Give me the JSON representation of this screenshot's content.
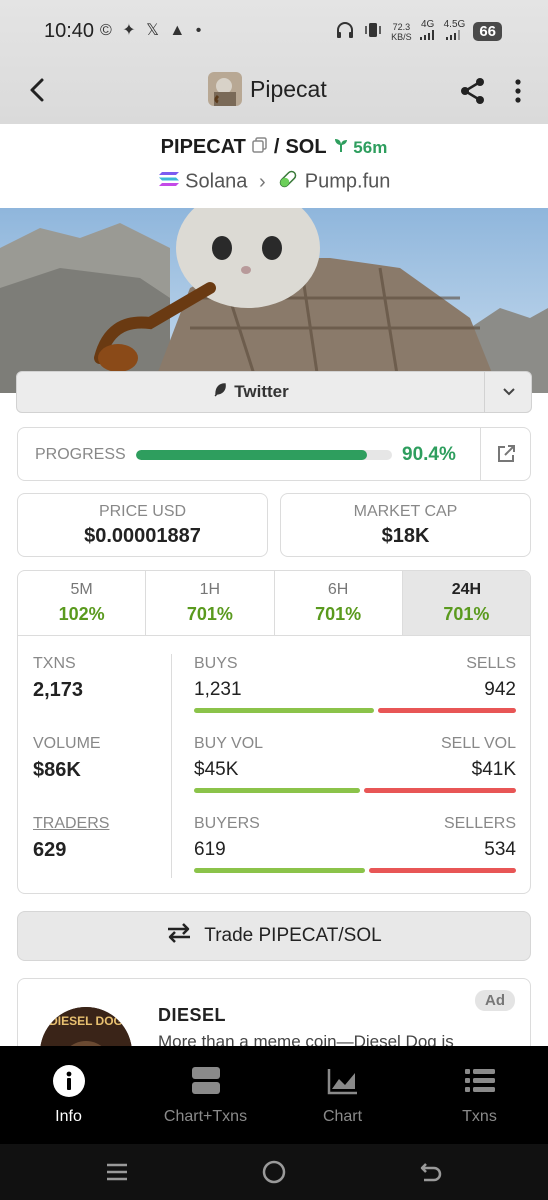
{
  "status_bar": {
    "time": "10:40",
    "left_icons": "© ✦ 𝕏 ▲ •",
    "data_rate": "72.3",
    "data_rate_unit": "KB/S",
    "network_1": "4G",
    "network_2": "4.5G",
    "battery": "66"
  },
  "toolbar": {
    "title": "Pipecat"
  },
  "pair": {
    "base": "PIPECAT",
    "separator": "/",
    "quote": "SOL",
    "age": "56m",
    "chain": "Solana",
    "dex": "Pump.fun"
  },
  "twitter": {
    "label": "Twitter"
  },
  "progress": {
    "label": "PROGRESS",
    "value": "90.4%",
    "fraction": 0.904
  },
  "price": {
    "label": "PRICE USD",
    "value": "$0.00001887"
  },
  "market_cap": {
    "label": "MARKET CAP",
    "value": "$18K"
  },
  "timeframes": [
    {
      "label": "5M",
      "value": "102%"
    },
    {
      "label": "1H",
      "value": "701%"
    },
    {
      "label": "6H",
      "value": "701%"
    },
    {
      "label": "24H",
      "value": "701%"
    }
  ],
  "txns": {
    "label": "TXNS",
    "value": "2,173",
    "left_label": "BUYS",
    "right_label": "SELLS",
    "left_value": "1,231",
    "right_value": "942",
    "left_share": 0.567
  },
  "volume": {
    "label": "VOLUME",
    "value": "$86K",
    "left_label": "BUY VOL",
    "right_label": "SELL VOL",
    "left_value": "$45K",
    "right_value": "$41K",
    "left_share": 0.523
  },
  "traders": {
    "label": "TRADERS",
    "value": "629",
    "left_label": "BUYERS",
    "right_label": "SELLERS",
    "left_value": "619",
    "right_value": "534",
    "left_share": 0.537
  },
  "trade_button": {
    "label": "Trade PIPECAT/SOL"
  },
  "ad": {
    "badge": "Ad",
    "title": "DIESEL",
    "description": "More than a meme coin—Diesel Dog is",
    "image_text": "DIESEL DOG"
  },
  "bottom_nav": [
    {
      "label": "Info"
    },
    {
      "label": "Chart+Txns"
    },
    {
      "label": "Chart"
    },
    {
      "label": "Txns"
    }
  ],
  "colors": {
    "accent_green": "#2e9e5e",
    "change_green": "#5a9a1e",
    "buy_bar": "#8bc34a",
    "sell_bar": "#e85656"
  }
}
